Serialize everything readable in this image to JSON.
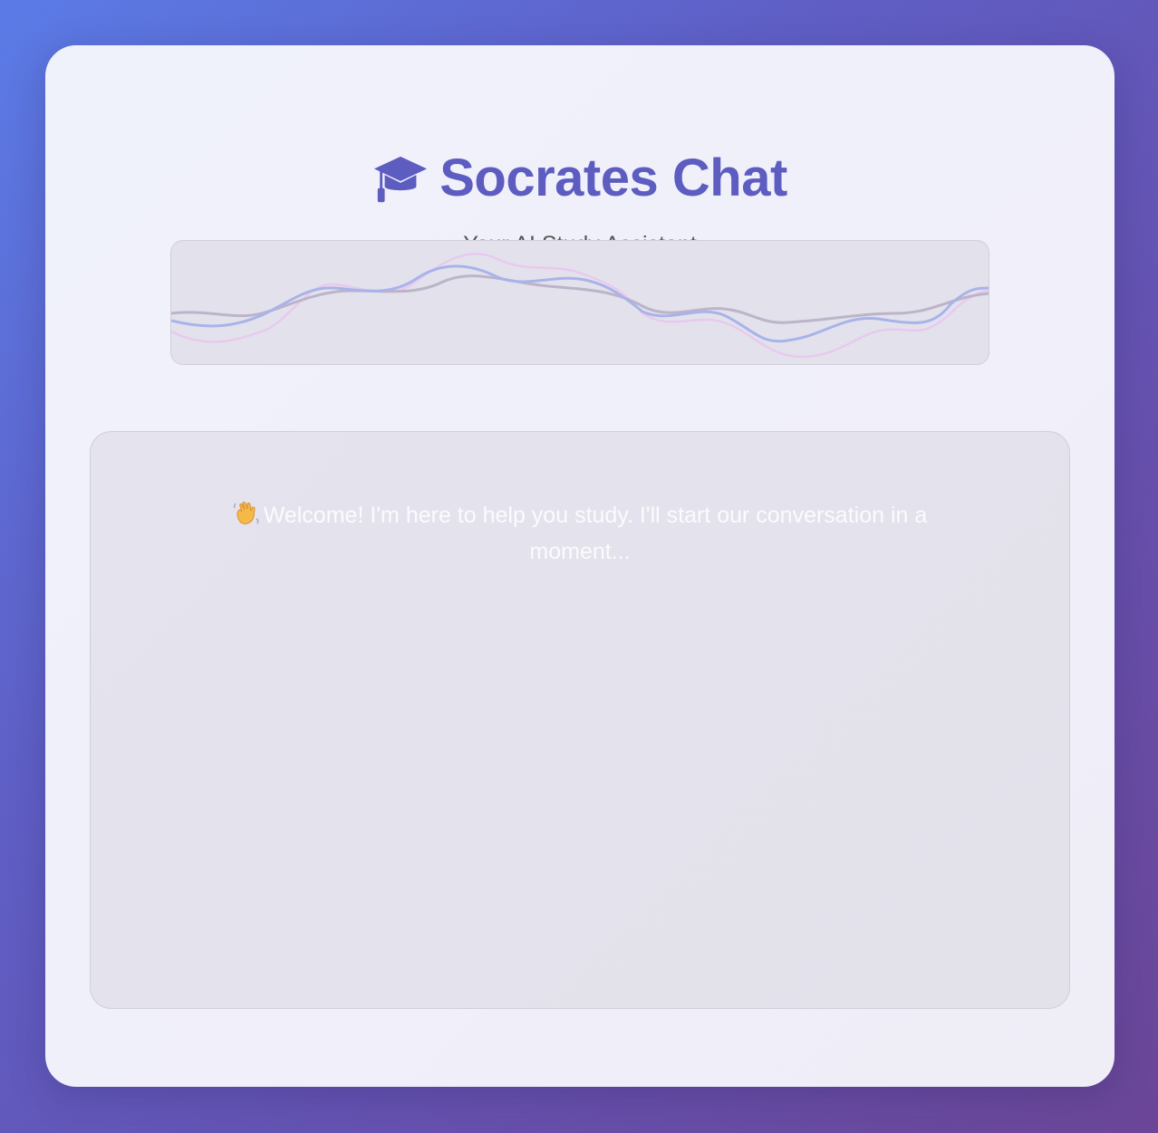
{
  "header": {
    "icon": "graduation-cap-icon",
    "title": "Socrates Chat",
    "subtitle": "Your AI Study Assistant"
  },
  "audio_visualizer": {
    "colors": {
      "wave_blue": "#a8b3ea",
      "wave_pink": "#e8c9ef",
      "wave_gray": "#bcb4c8"
    }
  },
  "chat": {
    "welcome_icon": "waving-hand-icon",
    "welcome_message": "Welcome! I'm here to help you study. I'll start our conversation in a moment..."
  },
  "colors": {
    "accent": "#5d5cc0",
    "background_start": "#5b7be6",
    "background_end": "#6b4697"
  }
}
